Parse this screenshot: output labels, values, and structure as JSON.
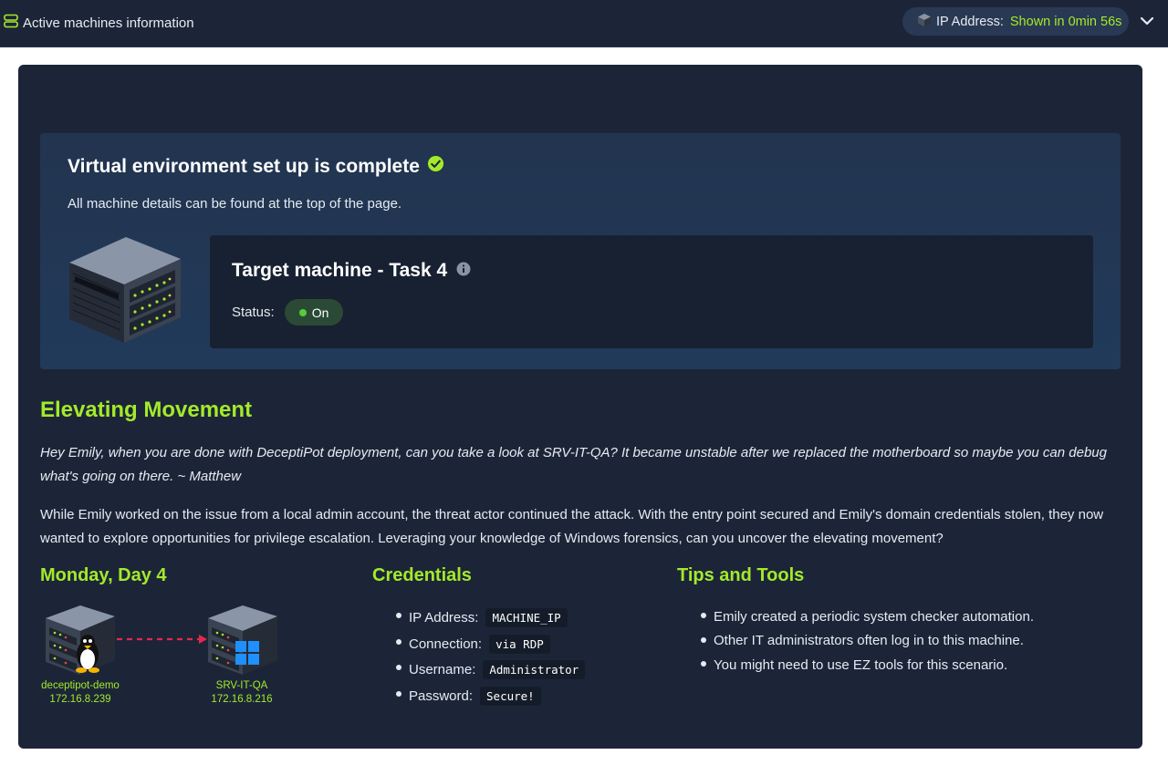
{
  "topbar": {
    "title": "Active machines information",
    "ip_label": "IP Address:",
    "ip_value": "Shown in 0min 56s"
  },
  "banner": {
    "title": "Virtual environment set up is complete",
    "subtitle": "All machine details can be found at the top of the page.",
    "machine_title": "Target machine - Task 4",
    "status_label": "Status:",
    "status_value": "On"
  },
  "content": {
    "heading": "Elevating Movement",
    "quote": "Hey Emily, when you are done with DeceptiPot deployment, can you take a look at SRV-IT-QA? It became unstable after we replaced the motherboard so maybe you can debug what's going on there. ~ Matthew",
    "paragraph": "While Emily worked on the issue from a local admin account, the threat actor continued the attack. With the entry point secured and Emily's domain credentials stolen, they now wanted to explore opportunities for privilege escalation. Leveraging your knowledge of Windows forensics, can you uncover the elevating movement?"
  },
  "day": {
    "title": "Monday, Day 4",
    "hosts": [
      {
        "name": "deceptipot-demo",
        "ip": "172.16.8.239",
        "os": "linux"
      },
      {
        "name": "SRV-IT-QA",
        "ip": "172.16.8.216",
        "os": "windows"
      }
    ]
  },
  "credentials": {
    "title": "Credentials",
    "items": [
      {
        "label": "IP Address:",
        "value": "MACHINE_IP"
      },
      {
        "label": "Connection:",
        "value": "via RDP"
      },
      {
        "label": "Username:",
        "value": "Administrator"
      },
      {
        "label": "Password:",
        "value": "Secure!"
      }
    ]
  },
  "tips": {
    "title": "Tips and Tools",
    "items": [
      "Emily created a periodic system checker automation.",
      "Other IT administrators often log in to this machine.",
      "You might need to use EZ tools for this scenario."
    ]
  },
  "colors": {
    "accent": "#a3ea2a",
    "background": "#1c2538",
    "status_on": "#57cc3a"
  }
}
